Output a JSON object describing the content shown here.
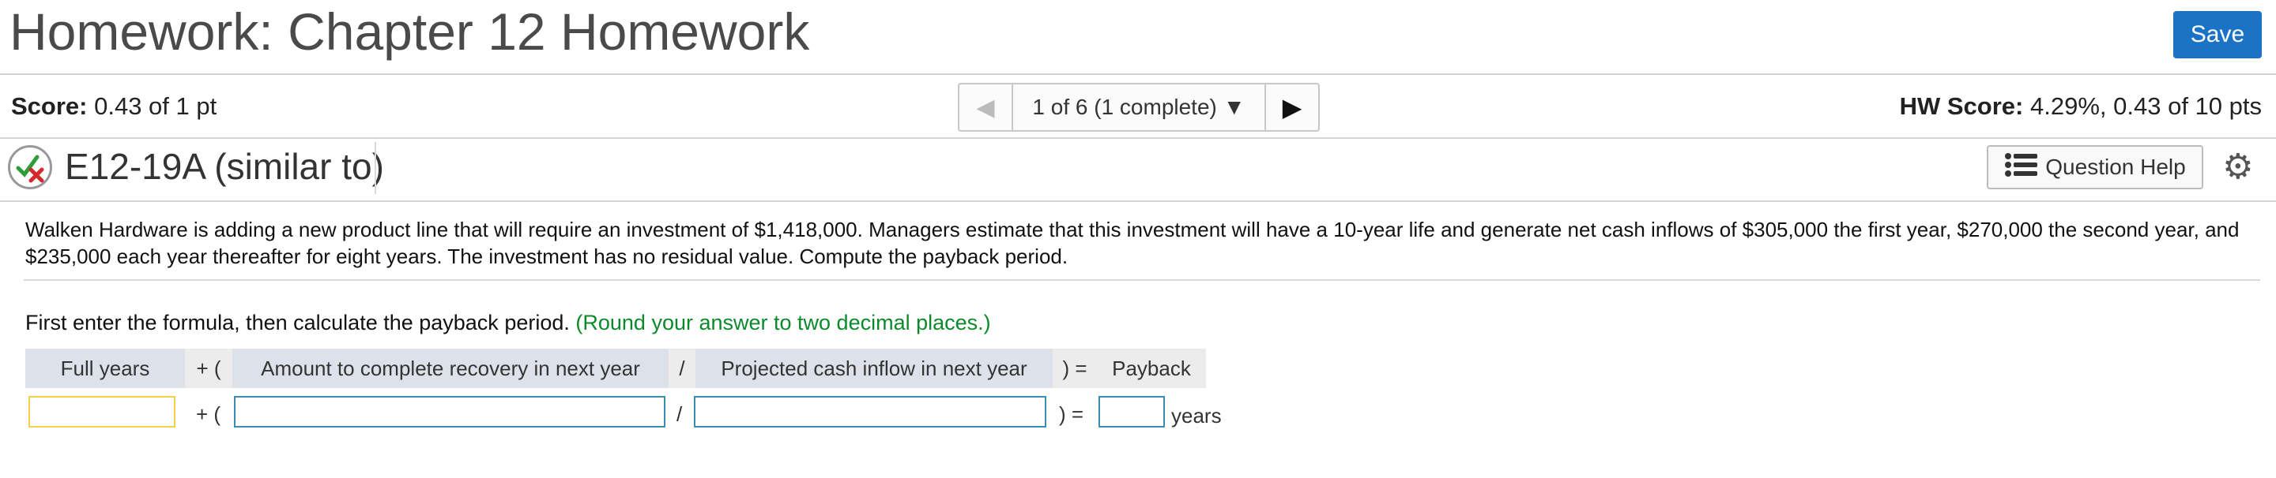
{
  "header": {
    "title": "Homework: Chapter 12 Homework",
    "save_label": "Save"
  },
  "score": {
    "label": "Score:",
    "value": "0.43 of 1 pt"
  },
  "navigator": {
    "position": "1 of 6 (1 complete)"
  },
  "hw_score": {
    "label": "HW Score:",
    "value": "4.29%, 0.43 of 10 pts"
  },
  "question": {
    "id": "E12-19A (similar to)",
    "help_label": "Question Help",
    "problem_text": "Walken Hardware is adding a new product line that will require an investment of $1,418,000. Managers estimate that this investment will have a 10-year life and generate net cash inflows of $305,000 the first year, $270,000 the second year, and $235,000 each year thereafter for eight years. The investment has no residual value. Compute the payback period.",
    "instruction": "First enter the formula, then calculate the payback period.",
    "instruction_hint": "(Round your answer to two decimal places.)"
  },
  "formula": {
    "headers": {
      "full_years": "Full years",
      "plus_open": "+ (",
      "amount": "Amount to complete recovery in next year",
      "divide": "/",
      "projected": "Projected cash inflow in next year",
      "close_eq": ") =",
      "payback": "Payback"
    },
    "row": {
      "full_years_value": "",
      "plus_open": "+ (",
      "amount_value": "",
      "divide": "/",
      "projected_value": "",
      "close_eq": ") =",
      "payback_value": "",
      "units": "years"
    }
  },
  "colors": {
    "accent": "#1a73c5",
    "hint_green": "#0b8a2c",
    "input_border": "#3a8fb7",
    "focus_yellow": "#f1d04a"
  }
}
